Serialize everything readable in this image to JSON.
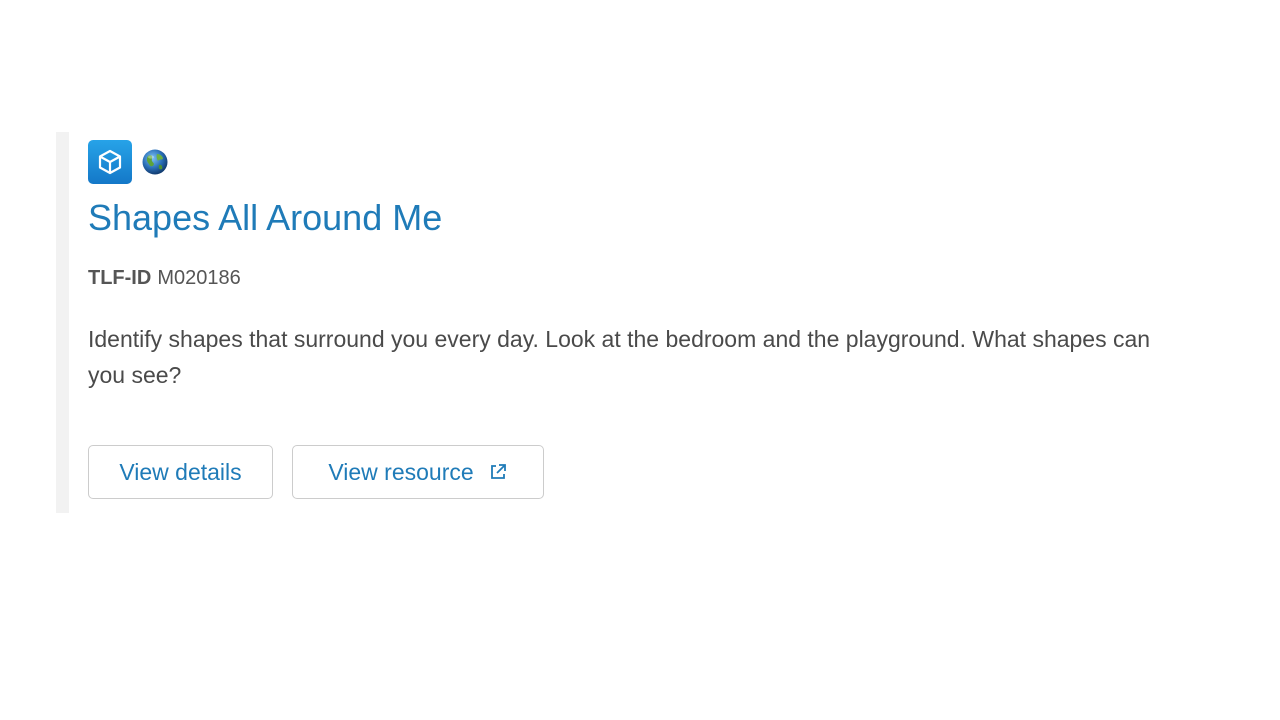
{
  "resource": {
    "type_icon": "cube-icon",
    "access_icon": "globe-icon",
    "title": "Shapes All Around Me",
    "id_label": "TLF-ID",
    "id_value": "M020186",
    "description": "Identify shapes that surround you every day. Look at the bedroom and the playground. What shapes can you see?"
  },
  "actions": {
    "view_details_label": "View details",
    "view_resource_label": "View resource",
    "view_resource_icon": "external-link-icon"
  },
  "colors": {
    "link": "#1f7bb8",
    "text": "#4a4a4a",
    "icon_bg": "#1a8ad8",
    "border": "#cccccc"
  }
}
